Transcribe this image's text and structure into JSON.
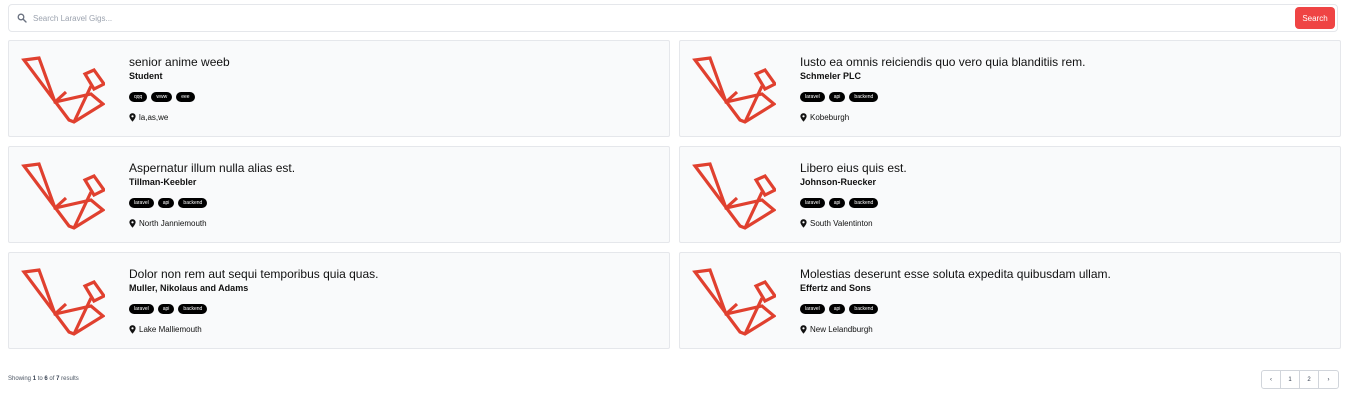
{
  "search": {
    "placeholder": "Search Laravel Gigs...",
    "button_label": "Search"
  },
  "colors": {
    "accent": "#ef4444",
    "card_bg": "#f9fafb",
    "logo_red": "#e0402f",
    "tag_bg": "#000000"
  },
  "listings": [
    {
      "title": "senior anime weeb",
      "company": "Student",
      "tags": [
        "qqq",
        "www",
        "eee"
      ],
      "location": "la,as,we"
    },
    {
      "title": "Iusto ea omnis reiciendis quo vero quia blanditiis rem.",
      "company": "Schmeler PLC",
      "tags": [
        "laravel",
        "api",
        "backend"
      ],
      "location": "Kobeburgh"
    },
    {
      "title": "Aspernatur illum nulla alias est.",
      "company": "Tillman-Keebler",
      "tags": [
        "laravel",
        "api",
        "backend"
      ],
      "location": "North Janniemouth"
    },
    {
      "title": "Libero eius quis est.",
      "company": "Johnson-Ruecker",
      "tags": [
        "laravel",
        "api",
        "backend"
      ],
      "location": "South Valentinton"
    },
    {
      "title": "Dolor non rem aut sequi temporibus quia quas.",
      "company": "Muller, Nikolaus and Adams",
      "tags": [
        "laravel",
        "api",
        "backend"
      ],
      "location": "Lake Malliemouth"
    },
    {
      "title": "Molestias deserunt esse soluta expedita quibusdam ullam.",
      "company": "Effertz and Sons",
      "tags": [
        "laravel",
        "api",
        "backend"
      ],
      "location": "New Lelandburgh"
    }
  ],
  "results": {
    "showing": "Showing",
    "from": "1",
    "to_word": "to",
    "to": "6",
    "of_word": "of",
    "total": "7",
    "results_word": "results"
  },
  "pagination": {
    "prev": "‹",
    "pages": [
      "1",
      "2"
    ],
    "next": "›"
  },
  "icons": {
    "search": "search-icon",
    "location": "map-pin-icon",
    "logo": "laravel-logo-icon"
  }
}
